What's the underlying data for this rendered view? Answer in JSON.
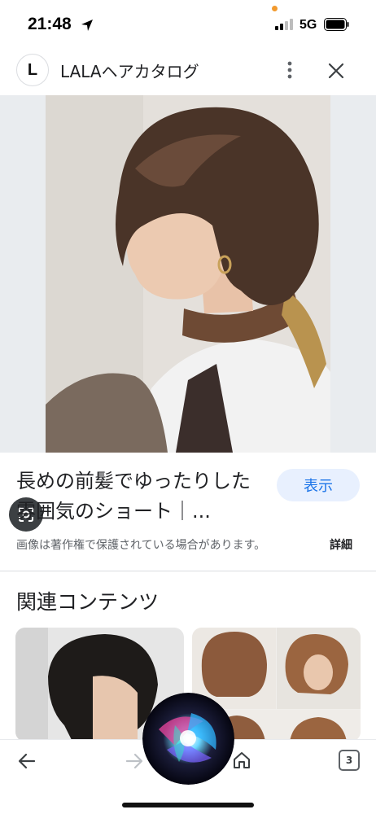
{
  "status_bar": {
    "time": "21:48",
    "network": "5G",
    "icons": [
      "location-arrow-icon",
      "signal-icon",
      "battery-icon"
    ]
  },
  "header": {
    "site_initial": "L",
    "site_name": "LALAヘアカタログ",
    "more_icon": "more-vert-icon",
    "close_icon": "close-icon"
  },
  "image": {
    "lens_icon": "google-lens-icon"
  },
  "result": {
    "title": "長めの前髪でゆったりした雰囲気のショート｜...",
    "show_button": "表示",
    "copyright_notice": "画像は著作権で保護されている場合があります。",
    "details_link": "詳細"
  },
  "related": {
    "heading": "関連コンテンツ"
  },
  "bottom_nav": {
    "tab_count": "3",
    "icons": [
      "back-arrow-icon",
      "forward-arrow-icon",
      "home-icon",
      "tabs-icon"
    ]
  },
  "colors": {
    "accent": "#1a73e8",
    "button_bg": "#e8f0fe",
    "muted_text": "#5f6368"
  }
}
